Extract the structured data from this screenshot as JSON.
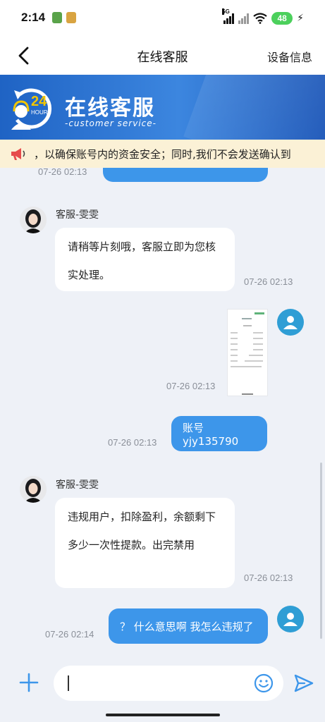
{
  "status_bar": {
    "time": "2:14",
    "network_label": "5G",
    "battery_level": "48",
    "colors": {
      "battery": "#4cd05c"
    }
  },
  "nav": {
    "title": "在线客服",
    "right_action": "设备信息",
    "back_icon": "chevron-left-icon"
  },
  "banner": {
    "badge_number": "24",
    "badge_caption": "HOURS",
    "title": "在线客服",
    "subtitle": "-customer service-",
    "colors": {
      "start": "#1f63c4",
      "end": "#3c86df"
    }
  },
  "notice": {
    "icon": "megaphone-icon",
    "text": "，以确保账号内的资金安全；同时,我们不会发送确认到"
  },
  "messages": [
    {
      "sender": "user",
      "type": "text",
      "text": "",
      "timestamp": "07-26 02:13"
    },
    {
      "sender": "agent",
      "name": "客服-雯雯",
      "type": "text",
      "lines": [
        "请稍等片刻哦，客服立即为您核",
        "实处理。"
      ],
      "timestamp": "07-26 02:13"
    },
    {
      "sender": "user",
      "type": "image",
      "timestamp": "07-26 02:13"
    },
    {
      "sender": "user",
      "type": "text",
      "text": "账号yjy135790",
      "timestamp": "07-26 02:13"
    },
    {
      "sender": "agent",
      "name": "客服-雯雯",
      "type": "text",
      "lines": [
        "违规用户，扣除盈利，余额剩下",
        "多少一次性提款。出完禁用"
      ],
      "timestamp": "07-26 02:13"
    },
    {
      "sender": "user",
      "type": "text",
      "text": "？ 什么意思啊 我怎么违规了",
      "timestamp": "07-26 02:14"
    }
  ],
  "input_bar": {
    "value": "",
    "plus_icon": "plus-icon",
    "emoji_icon": "emoji-icon",
    "send_icon": "send-icon",
    "accent_color": "#3d96ea"
  }
}
